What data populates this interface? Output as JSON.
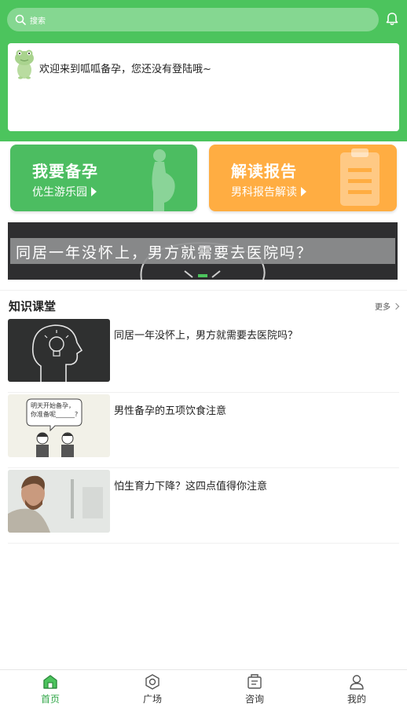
{
  "header": {
    "search_placeholder": "搜索",
    "welcome": "欢迎来到呱呱备孕，您还没有登陆哦~"
  },
  "promos": [
    {
      "title": "我要备孕",
      "subtitle": "优生游乐园",
      "color": "#4cbd61"
    },
    {
      "title": "解读报告",
      "subtitle": "男科报告解读",
      "color": "#ffad42"
    }
  ],
  "banner": {
    "text": "同居一年没怀上，男方就需要去医院吗？"
  },
  "knowledge": {
    "title": "知识课堂",
    "more": "更多",
    "articles": [
      {
        "title": "同居一年没怀上，男方就需要去医院吗？",
        "thumb": "chalkboard-head-bulb"
      },
      {
        "title": "男性备孕的五项饮食注意",
        "thumb": "cartoon-couple",
        "bubble": "明天开始备孕，你准备呢______?"
      },
      {
        "title": "怕生育力下降？这四点值得你注意",
        "thumb": "man-in-bathroom"
      }
    ]
  },
  "tabbar": {
    "items": [
      {
        "label": "首页",
        "icon": "home-icon",
        "active": true
      },
      {
        "label": "广场",
        "icon": "hexagon-icon",
        "active": false
      },
      {
        "label": "咨询",
        "icon": "chat-icon",
        "active": false
      },
      {
        "label": "我的",
        "icon": "user-icon",
        "active": false
      }
    ]
  },
  "colors": {
    "brand_green": "#4cc45d",
    "orange": "#ffad42",
    "active_tab": "#34a84b"
  }
}
